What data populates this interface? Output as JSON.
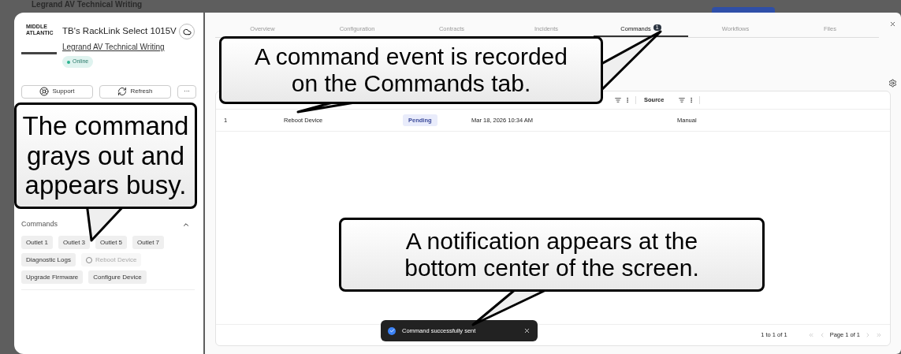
{
  "backdrop": {
    "title": "Legrand AV Technical Writing"
  },
  "device": {
    "brand": "MIDDLE ATLANTIC",
    "name": "TB's RackLink Select 1015V",
    "organization": "Legrand AV Technical Writing",
    "status": "Online",
    "online": true
  },
  "device_actions": [
    {
      "label": "Support",
      "kind": "support"
    },
    {
      "label": "Refresh",
      "kind": "refresh"
    },
    {
      "label": "···",
      "kind": "more"
    }
  ],
  "commands": {
    "title": "Commands",
    "expanded": true,
    "buttons": [
      {
        "label": "Outlet 1",
        "busy": false
      },
      {
        "label": "Outlet 3",
        "busy": false
      },
      {
        "label": "Outlet 5",
        "busy": false
      },
      {
        "label": "Outlet 7",
        "busy": false
      },
      {
        "label": "Diagnostic Logs",
        "busy": false
      },
      {
        "label": "Reboot Device",
        "busy": true
      },
      {
        "label": "Upgrade Firmware",
        "busy": false
      },
      {
        "label": "Configure Device",
        "busy": false
      }
    ]
  },
  "tabs": [
    {
      "label": "Overview",
      "selected": false
    },
    {
      "label": "Configuration",
      "selected": false
    },
    {
      "label": "Contracts",
      "selected": false
    },
    {
      "label": "Incidents",
      "selected": false
    },
    {
      "label": "Commands",
      "selected": true,
      "badge": "1"
    },
    {
      "label": "Workflows",
      "selected": false
    },
    {
      "label": "Files",
      "selected": false
    }
  ],
  "table": {
    "source_header": "Source",
    "rows": [
      {
        "index": "1",
        "command": "Reboot Device",
        "status": "Pending",
        "time": "Mar 18, 2026 10:34 AM",
        "source": "Manual"
      }
    ],
    "footer": {
      "range": "1 to 1 of 1",
      "page": "Page 1 of 1"
    }
  },
  "toast": {
    "message": "Command successfully sent"
  },
  "callouts": [
    {
      "text": "The command grays out and appears busy."
    },
    {
      "text": "A command event is recorded on the Commands tab."
    },
    {
      "text": "A notification appears at the bottom center of the screen."
    }
  ]
}
